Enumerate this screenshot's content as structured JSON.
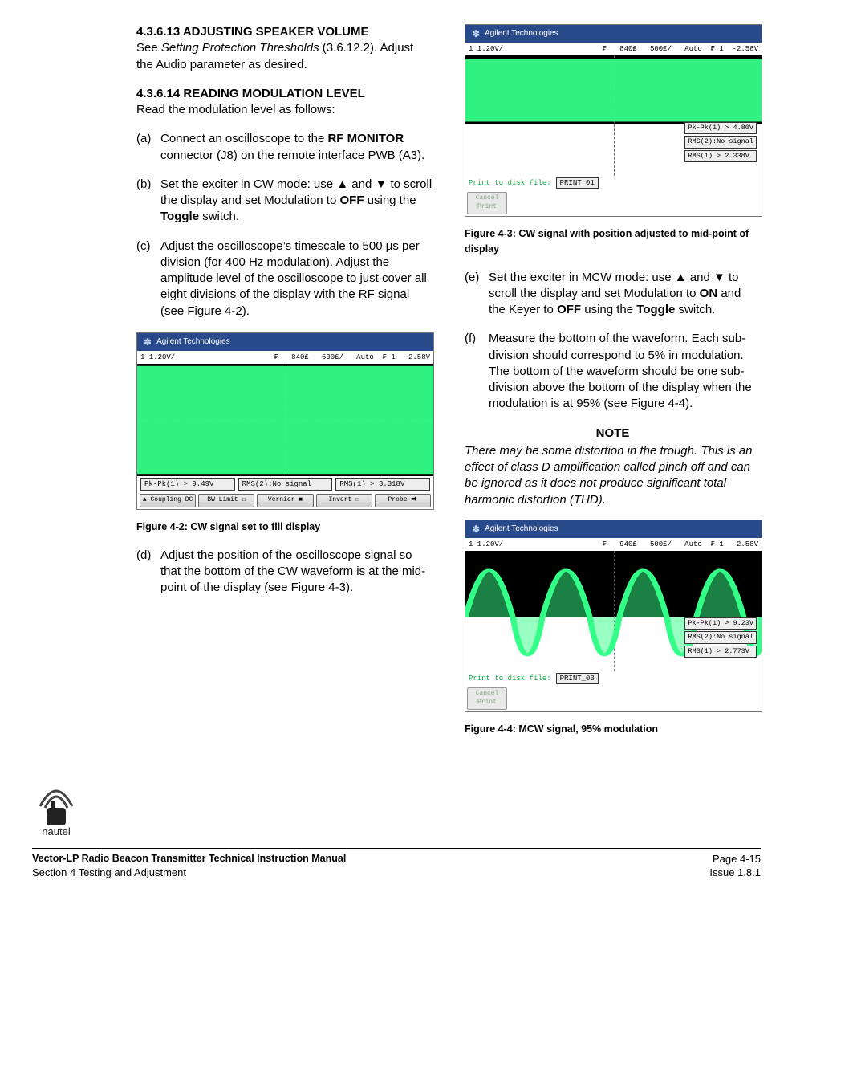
{
  "col1": {
    "h1": "4.3.6.13 ADJUSTING SPEAKER VOLUME",
    "p1_a": "See ",
    "p1_i": "Setting Protection Thresholds",
    "p1_b": " (3.6.12.2). Adjust the Audio parameter as desired.",
    "h2": "4.3.6.14 READING MODULATION LEVEL",
    "p2": "Read the modulation level as follows:",
    "a": {
      "m": "(a)",
      "t1": "Connect an oscilloscope to the ",
      "b1": "RF MONITOR",
      "t2": " connector (J8) on the remote interface PWB (A3)."
    },
    "b": {
      "m": "(b)",
      "t1": "Set the exciter in CW mode: use ▲ and ▼ to scroll the display and set Modulation to ",
      "b1": "OFF",
      "t2": " using the ",
      "b2": "Toggle",
      "t3": " switch."
    },
    "c": {
      "m": "(c)",
      "t": "Adjust the oscilloscope’s timescale to 500 μs per division (for 400 Hz modulation). Adjust the amplitude level of the oscilloscope to just cover all eight divisions of the display with the RF signal (see Figure 4-2)."
    },
    "fig42_caption": "Figure 4-2:  CW signal set to fill display",
    "d": {
      "m": "(d)",
      "t": "Adjust the position of the oscilloscope signal so that the bottom of the CW waveform is at the mid-point of the display (see Figure 4-3)."
    }
  },
  "col2": {
    "fig43_caption": "Figure 4-3:  CW signal with position adjusted to mid-point of display",
    "e": {
      "m": "(e)",
      "t1": "Set the exciter in MCW mode: use ▲ and ▼ to scroll the display and set Modulation to ",
      "b1": "ON",
      "t2": " and the Keyer to ",
      "b2": "OFF",
      "t3": " using the ",
      "b3": "Toggle",
      "t4": " switch."
    },
    "f": {
      "m": "(f)",
      "t": "Measure the bottom of the waveform. Each sub-division should correspond to 5% in modulation. The bottom of the waveform should be one sub-division above the bottom of the display when the modulation is at 95% (see Figure 4-4)."
    },
    "note_title": "NOTE",
    "note_body": "There may be some distortion in the trough. This is an effect of class D amplification called pinch off and can be ignored as it does not produce significant total harmonic distortion (THD).",
    "fig44_caption": "Figure 4-4:  MCW signal, 95% modulation"
  },
  "scope": {
    "brand": "Agilent Technologies",
    "hdr_left": "1 1.20V/",
    "hdr_right_42": "₣   840₤   500₤/   Auto  ₣ 1  -2.58V",
    "hdr_right_43": "₣   840₤   500₤/   Auto  ₣ 1  -2.58V",
    "hdr_right_44": "₣   940₤   500₤/   Auto  ₣ 1  -2.58V",
    "fig42": {
      "r1": "Pk-Pk(1) > 9.49V",
      "r2": "RMS(2):No signal",
      "r3": "RMS(1) > 3.318V",
      "b1": "▲ Coupling\nDC",
      "b2": "BW Limit\n☐",
      "b3": "Vernier\n■",
      "b4": "Invert\n☐",
      "b5": "Probe\n⮕"
    },
    "fig43": {
      "r1": "Pk-Pk(1) > 4.80V",
      "r2": "RMS(2):No signal",
      "r3": "RMS(1) > 2.338V",
      "print": "Print to disk file:",
      "file": "PRINT_01",
      "cancel": "Cancel\nPrint"
    },
    "fig44": {
      "r1": "Pk-Pk(1) > 9.23V",
      "r2": "RMS(2):No signal",
      "r3": "RMS(1) > 2.773V",
      "print": "Print to disk file:",
      "file": "PRINT_03",
      "cancel": "Cancel\nPrint"
    }
  },
  "footer": {
    "logo_text": "nautel",
    "l1_left": "Vector-LP Radio Beacon Transmitter Technical Instruction Manual",
    "l1_right": "Page 4-15",
    "l2_left": "Section 4 Testing and Adjustment",
    "l2_right": "Issue 1.8.1"
  }
}
